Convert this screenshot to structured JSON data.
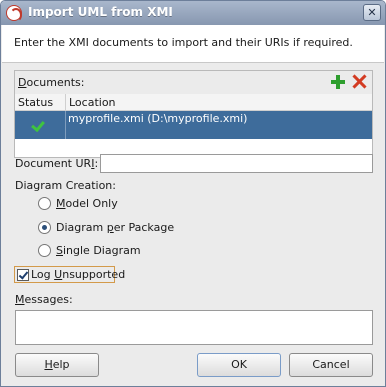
{
  "dialog": {
    "title": "Import UML from XMI",
    "close_symbol": "✕",
    "header_text": "Enter the XMI documents to import and their URIs if required."
  },
  "documents": {
    "label_pre": "",
    "label_mnemonic": "D",
    "label_post": "ocuments:",
    "add_icon": "add-icon",
    "remove_icon": "remove-icon",
    "columns": [
      "Status",
      "Location"
    ],
    "rows": [
      {
        "status_icon": "check-icon",
        "location": "myprofile.xmi (D:\\myprofile.xmi)"
      }
    ]
  },
  "document_uri": {
    "label_pre": "Document UR",
    "label_mnemonic": "I",
    "label_post": ":",
    "value": ""
  },
  "diagram_creation": {
    "label": "Diagram Creation:",
    "options": [
      {
        "pre": "",
        "mnemonic": "M",
        "post": "odel Only",
        "selected": false
      },
      {
        "pre": "Diagram ",
        "mnemonic": "p",
        "post": "er Package",
        "selected": true
      },
      {
        "pre": "",
        "mnemonic": "S",
        "post": "ingle Diagram",
        "selected": false
      }
    ]
  },
  "log_unsupported": {
    "pre": "Log ",
    "mnemonic": "U",
    "post": "nsupported",
    "checked": true
  },
  "messages": {
    "label_pre": "",
    "label_mnemonic": "M",
    "label_post": "essages:",
    "value": ""
  },
  "buttons": {
    "help_pre": "",
    "help_mnemonic": "H",
    "help_post": "elp",
    "ok": "OK",
    "cancel": "Cancel"
  },
  "colors": {
    "selection": "#3e6c9b",
    "title_bar": "#8797b0",
    "add": "#2e9e2e",
    "remove": "#d33b22"
  }
}
